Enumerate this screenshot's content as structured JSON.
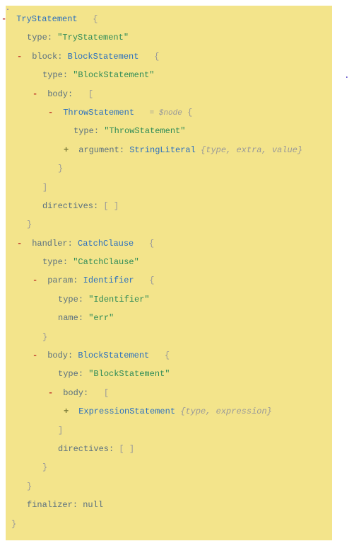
{
  "labels": {
    "minus": "-",
    "plus": "+",
    "colon": ":",
    "obrace": "{",
    "cbrace": "}",
    "obracket": "[",
    "cbracket": "]",
    "emptyArr": "[ ]",
    "eq": "=",
    "comma": ", "
  },
  "fields": {
    "type": "type",
    "block": "block",
    "body": "body",
    "directives": "directives",
    "handler": "handler",
    "param": "param",
    "name": "name",
    "argument": "argument",
    "finalizer": "finalizer"
  },
  "types": {
    "TryStatement": "TryStatement",
    "BlockStatement": "BlockStatement",
    "ThrowStatement": "ThrowStatement",
    "StringLiteral": "StringLiteral",
    "CatchClause": "CatchClause",
    "Identifier": "Identifier",
    "ExpressionStatement": "ExpressionStatement"
  },
  "strings": {
    "TryStatement": "\"TryStatement\"",
    "BlockStatement": "\"BlockStatement\"",
    "ThrowStatement": "\"ThrowStatement\"",
    "CatchClause": "\"CatchClause\"",
    "Identifier": "\"Identifier\"",
    "err": "\"err\""
  },
  "values": {
    "null": "null",
    "nodevar": "$node"
  },
  "preview": {
    "stringLit_type": "type",
    "stringLit_extra": "extra",
    "stringLit_value": "value",
    "exprStmt_type": "type",
    "exprStmt_expr": "expression"
  }
}
